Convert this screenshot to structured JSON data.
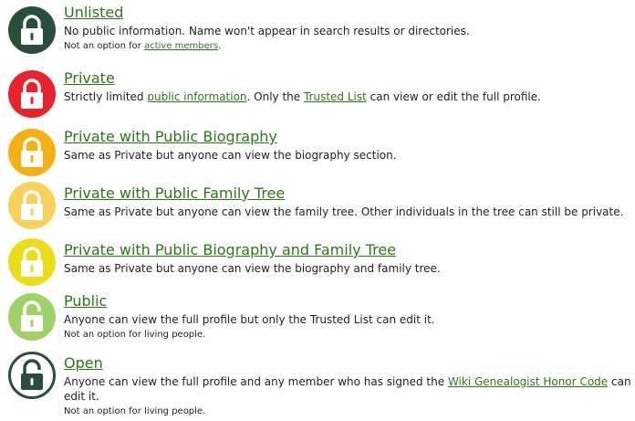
{
  "colors": {
    "link": "#2a7a14",
    "unlisted": "#274f3a",
    "private": "#e8232b",
    "private_bio": "#f7b014",
    "private_tree": "#f8d15a",
    "private_bio_tree": "#ecdd19",
    "public": "#9fd267",
    "open": "#274f3a"
  },
  "items": [
    {
      "icon": "lock-closed-icon",
      "title": "Unlisted",
      "desc": "No public information. Name won't appear in search results or directories.",
      "note_pre": "Not an option for ",
      "note_link": "active members",
      "note_post": "."
    },
    {
      "icon": "lock-closed-icon",
      "title": "Private",
      "desc_pre": "Strictly limited ",
      "desc_link1": "public information",
      "desc_mid": ". Only the ",
      "desc_link2": "Trusted List",
      "desc_post": " can view or edit the full profile."
    },
    {
      "icon": "lock-closed-icon",
      "title": "Private with Public Biography",
      "desc": "Same as Private but anyone can view the biography section."
    },
    {
      "icon": "lock-closed-icon",
      "title": "Private with Public Family Tree",
      "desc": "Same as Private but anyone can view the family tree. Other individuals in the tree can still be private."
    },
    {
      "icon": "lock-closed-icon",
      "title": "Private with Public Biography and Family Tree",
      "desc": "Same as Private but anyone can view the biography and family tree."
    },
    {
      "icon": "lock-open-icon",
      "title": "Public",
      "desc": "Anyone can view the full profile but only the Trusted List can edit it.",
      "note": "Not an option for living people."
    },
    {
      "icon": "lock-open-icon",
      "title": "Open",
      "desc_pre": "Anyone can view the full profile and any member who has signed the ",
      "desc_link": "Wiki Genealogist Honor Code",
      "desc_post": " can edit it.",
      "note": "Not an option for living people."
    }
  ]
}
